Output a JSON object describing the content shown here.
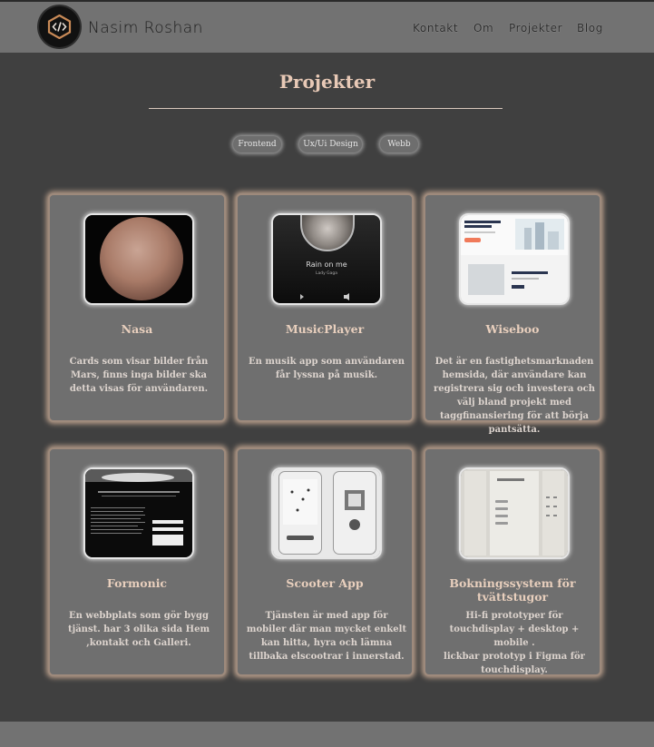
{
  "header": {
    "brand": "Nasim Roshan",
    "logo_icon": "code-hexagon-icon",
    "nav": [
      "Kontakt",
      "Om",
      "Projekter",
      "Blog"
    ]
  },
  "main": {
    "title": "Projekter",
    "filters": [
      "Frontend",
      "Ux/Ui Design",
      "Webb"
    ]
  },
  "projects": [
    {
      "title": "Nasa",
      "description": "Cards som visar bilder från Mars, finns inga bilder ska detta visas för användaren."
    },
    {
      "title": "MusicPlayer",
      "description": "En musik app som användaren får lyssna på musik.",
      "thumb_title": "Rain on me",
      "thumb_artist": "Lady Gaga"
    },
    {
      "title": "Wiseboo",
      "description": "Det är en fastighetsmarknaden hemsida, där användare kan registrera sig och investera och välj bland projekt med taggfinansiering för att börja pantsätta."
    },
    {
      "title": "Formonic",
      "description": "En webbplats som gör bygg tjänst. har 3 olika sida Hem ,kontakt och Galleri."
    },
    {
      "title": "Scooter App",
      "description": "Tjänsten är med app för mobiler där man mycket enkelt kan hitta, hyra och lämna tillbaka elscootrar i innerstad."
    },
    {
      "title": "Bokningssystem för tvättstugor",
      "description": "Hi-fi prototyper för touchdisplay + desktop + mobile .\nlickbar prototyp i Figma för touchdisplay."
    }
  ],
  "colors": {
    "background": "#404040",
    "header": "#727272",
    "card": "#6f6f6f",
    "accent": "#e8c9b6"
  }
}
